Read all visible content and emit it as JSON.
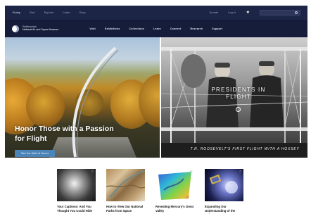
{
  "utility_bar": {
    "links": [
      "Today",
      "Visit",
      "Explore",
      "Learn",
      "Shop"
    ],
    "right_link_1": "Donate",
    "right_link_2": "Log In",
    "star_icon": "star-icon",
    "search_icon": "search-icon"
  },
  "header": {
    "logo_line1": "Smithsonian",
    "logo_line2": "National Air and Space Museum",
    "nav": [
      "Visit",
      "Exhibitions",
      "Collections",
      "Learn",
      "Connect",
      "Research",
      "Support"
    ]
  },
  "hero_left": {
    "title": "Honor Those with a Passion for Flight",
    "cta": "See the Wall of Honor"
  },
  "hero_right": {
    "title": "PRESIDENTS IN FLIGHT",
    "caption": "T.R. ROOSEVELT'S FIRST FLIGHT WITH A HOXSEY"
  },
  "cards": [
    {
      "title": "Your Captions: And You Thought You Could Hide"
    },
    {
      "title": "How to View Our National Parks from Space"
    },
    {
      "title": "Revealing Mercury's Great Valley"
    },
    {
      "title": "Expanding Our Understanding of the Universe"
    }
  ],
  "colors": {
    "utility_bar": "#1c2545",
    "header": "#151d3a",
    "cta": "#4a84b8"
  }
}
